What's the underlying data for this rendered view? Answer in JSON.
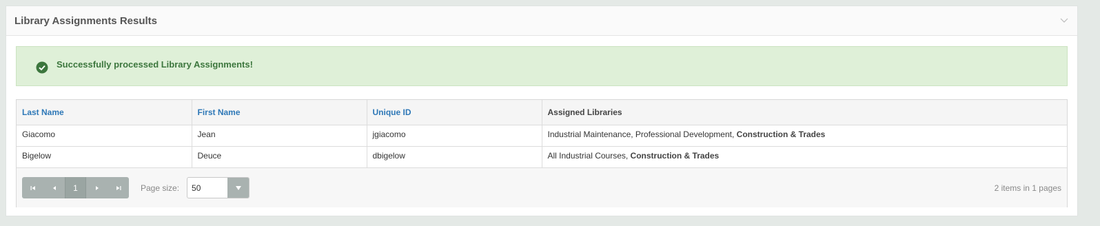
{
  "panel": {
    "title": "Library Assignments Results"
  },
  "alert": {
    "message": "Successfully processed Library Assignments!",
    "color": "#3c763d"
  },
  "grid": {
    "columns": [
      "Last Name",
      "First Name",
      "Unique ID",
      "Assigned Libraries"
    ],
    "rows": [
      {
        "last_name": "Giacomo",
        "first_name": "Jean",
        "unique_id": "jgiacomo",
        "libraries_plain": "Industrial Maintenance, Professional Development, ",
        "libraries_bold": "Construction  & Trades"
      },
      {
        "last_name": "Bigelow",
        "first_name": "Deuce",
        "unique_id": "dbigelow",
        "libraries_plain": "All Industrial Courses, ",
        "libraries_bold": "Construction  & Trades"
      }
    ]
  },
  "pager": {
    "current_page": "1",
    "page_size_label": "Page size:",
    "page_size_value": "50",
    "info": "2 items in 1 pages"
  }
}
